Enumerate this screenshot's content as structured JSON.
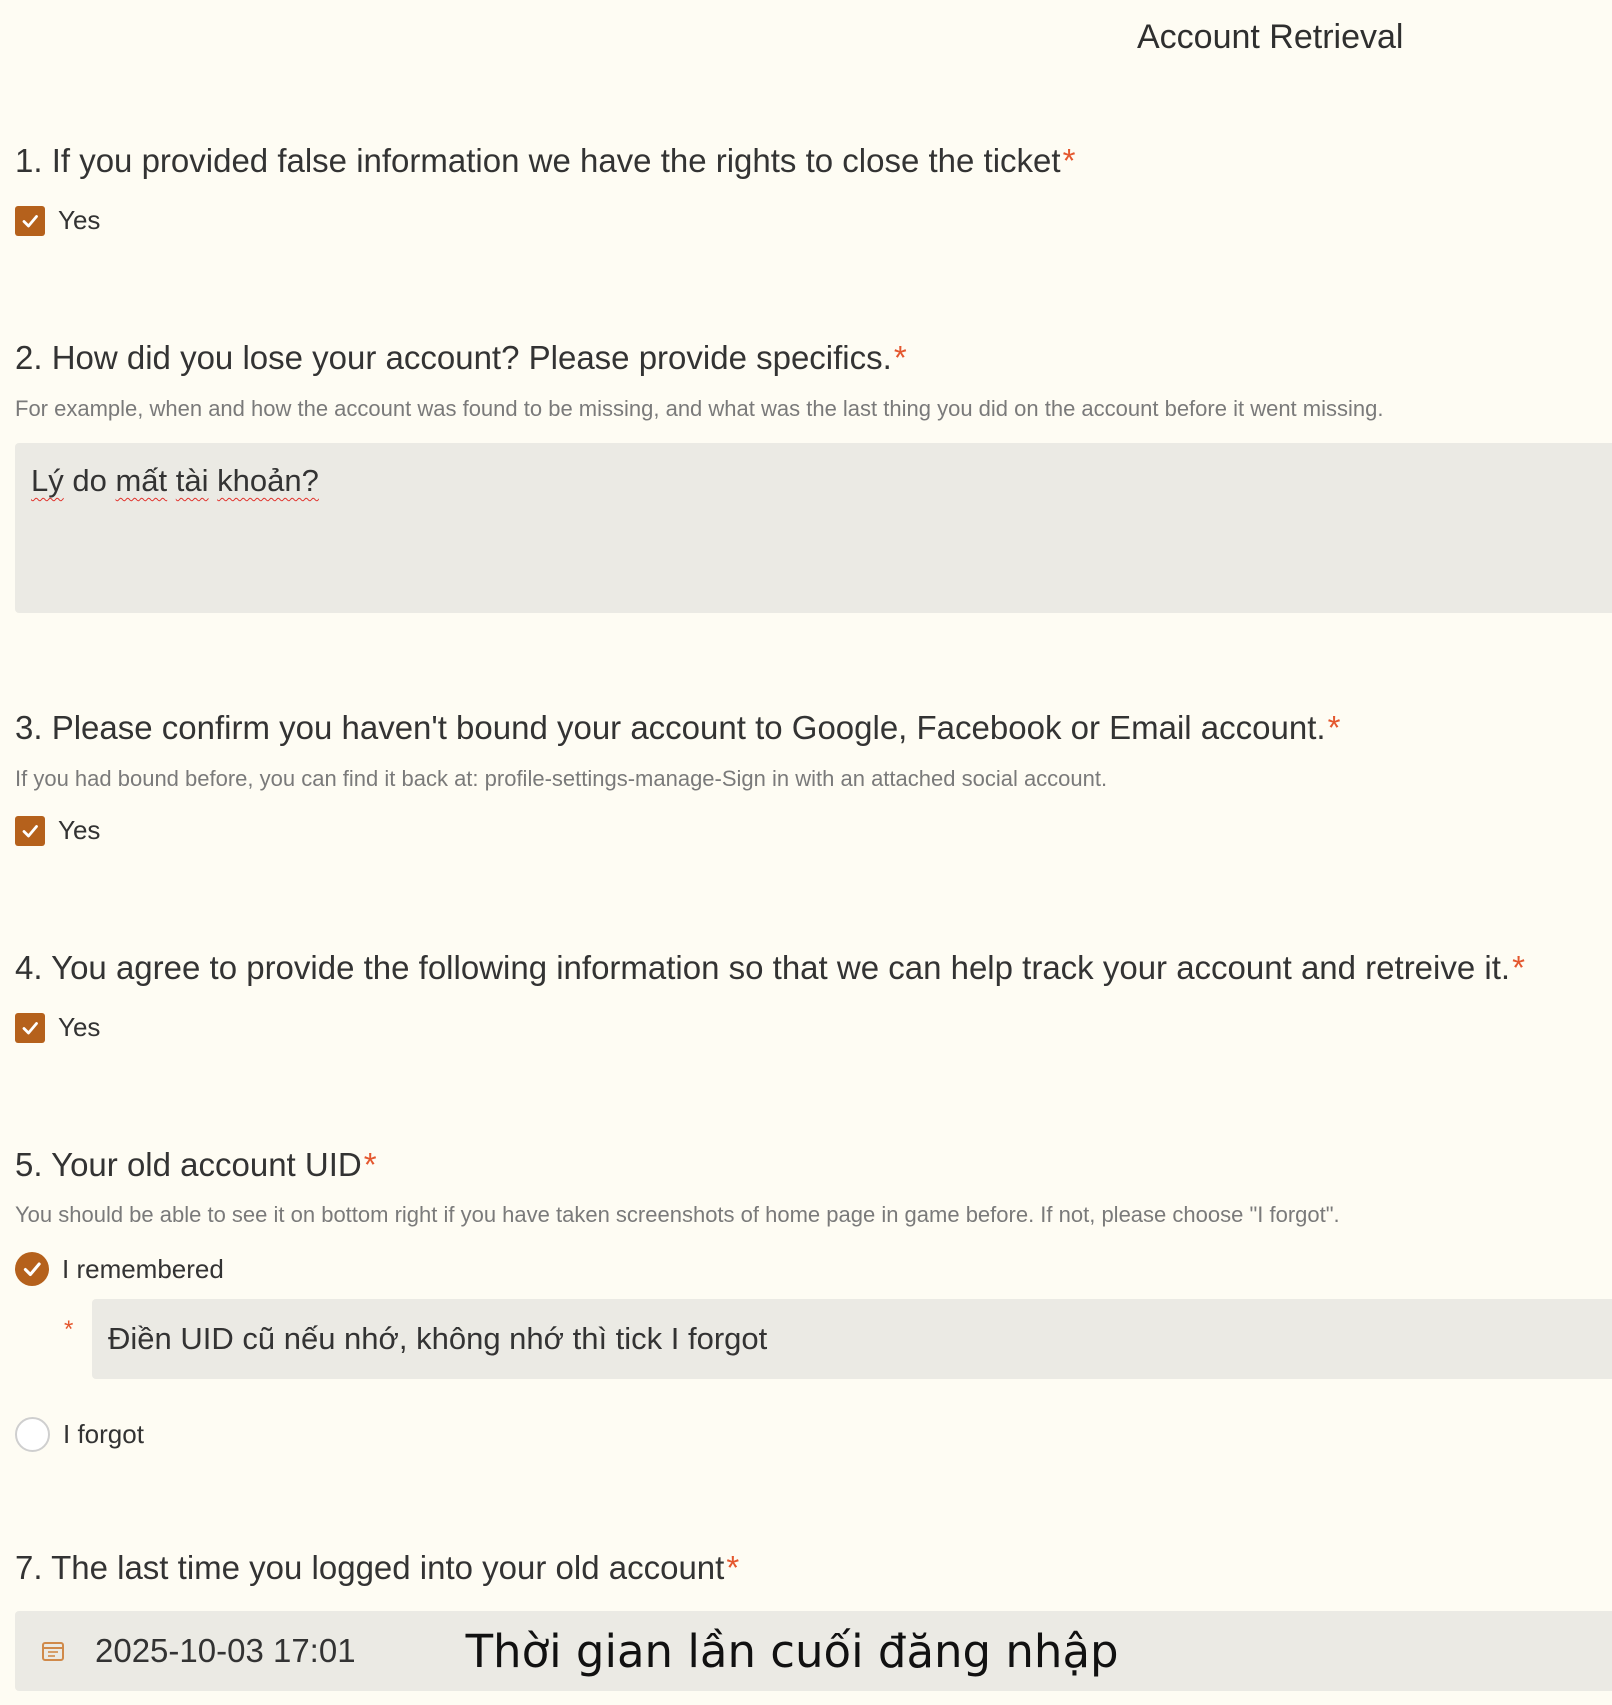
{
  "page_title": "Account Retrieval",
  "colors": {
    "accent": "#b5611c",
    "required": "#e4572e",
    "field_bg": "#ebeae4",
    "page_bg": "#fefcf3"
  },
  "questions": {
    "q1": {
      "title": "1. If you provided false information we have the rights to close the ticket",
      "required_mark": "*",
      "option": "Yes",
      "checked": true
    },
    "q2": {
      "title": "2. How did you lose your account? Please provide specifics.",
      "required_mark": "*",
      "hint": "For example, when and how the account was found to be missing, and what was the last thing you did on the account before it went missing.",
      "answer_words": [
        "Lý",
        "do",
        "mất",
        "tài",
        "khoản?"
      ]
    },
    "q3": {
      "title": "3. Please confirm you haven't bound your account to Google, Facebook or Email account.",
      "required_mark": "*",
      "hint": "If you had bound before, you can find it back at: profile-settings-manage-Sign in with an attached social account.",
      "option": "Yes",
      "checked": true
    },
    "q4": {
      "title": "4. You agree to provide the following information so that we can help track your account and retreive it.",
      "required_mark": "*",
      "option": "Yes",
      "checked": true
    },
    "q5": {
      "title": "5. Your old account UID",
      "required_mark": "*",
      "hint": "You should be able to see it on bottom right if you have taken screenshots of home page in game before. If not, please choose \"I forgot\".",
      "options": [
        {
          "label": "I remembered",
          "selected": true
        },
        {
          "label": "I forgot",
          "selected": false
        }
      ],
      "uid_required_mark": "*",
      "uid_value": "Điền UID cũ nếu nhớ, không nhớ thì tick I forgot"
    },
    "q7": {
      "title": "7. The last time you logged into your old account",
      "required_mark": "*",
      "datetime_value": "2025-10-03 17:01",
      "overlay_caption": "Thời gian lần cuối đăng nhập",
      "icon": "calendar-icon"
    }
  }
}
